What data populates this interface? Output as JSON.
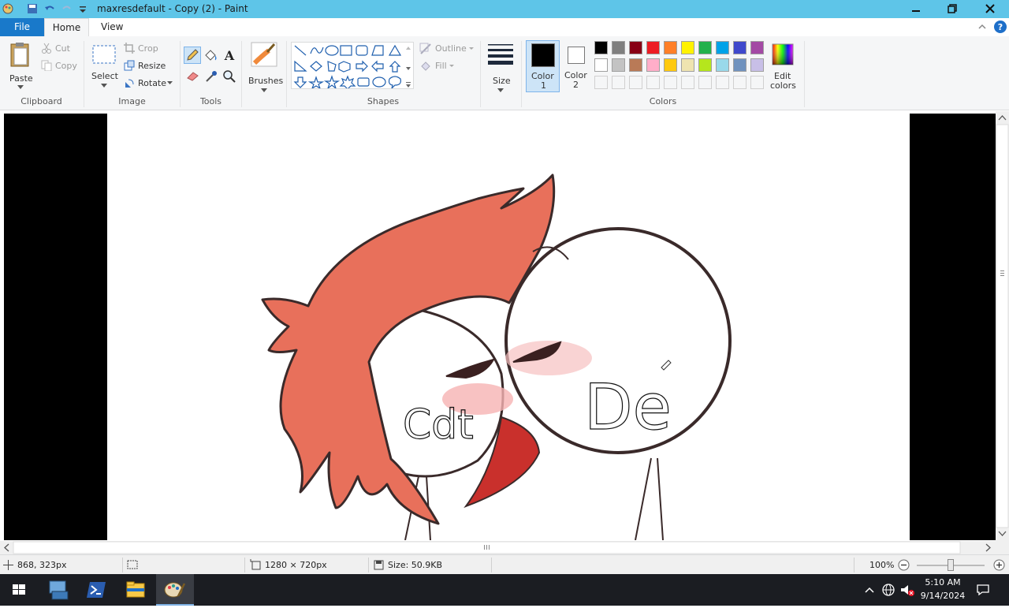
{
  "window": {
    "title": "maxresdefault - Copy (2) - Paint",
    "buttons": [
      "minimize",
      "restore",
      "close"
    ]
  },
  "ribbon": {
    "tabs": [
      "File",
      "Home",
      "View"
    ],
    "clipboard": {
      "paste": "Paste",
      "cut": "Cut",
      "copy": "Copy",
      "label": "Clipboard"
    },
    "image": {
      "select": "Select",
      "crop": "Crop",
      "resize": "Resize",
      "rotate": "Rotate",
      "label": "Image"
    },
    "tools": {
      "label": "Tools",
      "items": [
        "pencil-icon",
        "fill-icon",
        "text-icon",
        "eraser-icon",
        "color-picker-icon",
        "magnifier-icon"
      ]
    },
    "brushes": {
      "label": "Brushes"
    },
    "shapes": {
      "label": "Shapes",
      "outline": "Outline",
      "fill": "Fill"
    },
    "size": {
      "label": "Size"
    },
    "color1": {
      "label": "Color",
      "num": "1",
      "value": "#000000"
    },
    "color2": {
      "label": "Color",
      "num": "2",
      "value": "#ffffff"
    },
    "colors": {
      "label": "Colors",
      "row1": [
        "#000000",
        "#7f7f7f",
        "#880015",
        "#ed1c24",
        "#ff7f27",
        "#fff200",
        "#22b14c",
        "#00a2e8",
        "#3f48cc",
        "#a349a4"
      ],
      "row2": [
        "#ffffff",
        "#c3c3c3",
        "#b97a57",
        "#ffaec9",
        "#ffc90e",
        "#efe4b0",
        "#b5e61d",
        "#99d9ea",
        "#7092be",
        "#c8bfe7"
      ]
    },
    "edit_colors": {
      "line1": "Edit",
      "line2": "colors"
    }
  },
  "canvas": {
    "handwriting": [
      "Cdt",
      "De"
    ]
  },
  "statusbar": {
    "cursor": "868, 323px",
    "dimensions": "1280 × 720px",
    "size": "Size: 50.9KB",
    "zoom": "100%"
  },
  "taskbar": {
    "time": "5:10 AM",
    "date": "9/14/2024",
    "apps": [
      "start-button",
      "server-manager-icon",
      "powershell-icon",
      "file-explorer-icon",
      "paint-icon"
    ]
  }
}
